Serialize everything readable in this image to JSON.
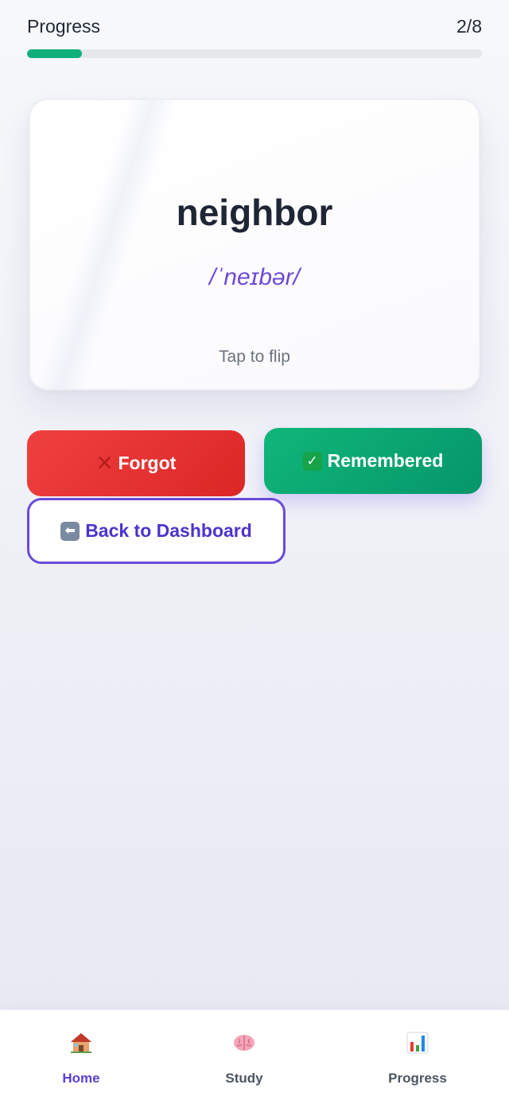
{
  "progress": {
    "label": "Progress",
    "count_text": "2/8",
    "fraction": 0.12
  },
  "card": {
    "word": "neighbor",
    "phonetic": "/ˈneɪbər/",
    "hint": "Tap to flip"
  },
  "actions": {
    "forgot_label": "Forgot",
    "remembered_label": "Remembered",
    "back_label": "Back to Dashboard"
  },
  "nav": {
    "items": [
      {
        "label": "Home",
        "icon": "house-icon",
        "active": true
      },
      {
        "label": "Study",
        "icon": "brain-icon",
        "active": false
      },
      {
        "label": "Progress",
        "icon": "bar-chart-icon",
        "active": false
      }
    ]
  },
  "colors": {
    "progress_fill": "#10b07a",
    "forgot": "#dc2626",
    "remembered": "#059669",
    "accent": "#5b3fd6"
  }
}
